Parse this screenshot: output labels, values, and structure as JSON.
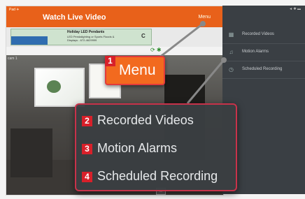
{
  "app": {
    "status_left": "Pad ✈",
    "title": "Watch Live Video",
    "menu_link": "Menu",
    "ad": {
      "line1": "Holiday LED Pendants",
      "line2": "LED Pendalighting or Sports Floods &",
      "line3": "Displays - 672-4629999",
      "go": "C"
    },
    "sub_icons": "⟳ ✱",
    "camera_label": "cam 1",
    "video_icon": "▭"
  },
  "sidebar": {
    "status": "◄ ✱ ▬",
    "items": [
      {
        "label": "Recorded Videos",
        "icon": "film-icon"
      },
      {
        "label": "Motion Alarms",
        "icon": "bell-icon"
      },
      {
        "label": "Scheduled Recording",
        "icon": "clock-icon"
      }
    ]
  },
  "callouts": {
    "menu_badge": "1",
    "menu_label": "Menu",
    "popup": [
      {
        "badge": "2",
        "label": "Recorded Videos"
      },
      {
        "badge": "3",
        "label": "Motion Alarms"
      },
      {
        "badge": "4",
        "label": "Scheduled Recording"
      }
    ]
  },
  "colors": {
    "accent": "#e8611a",
    "badge": "#d8202a",
    "sidebar": "#3a3f44"
  }
}
